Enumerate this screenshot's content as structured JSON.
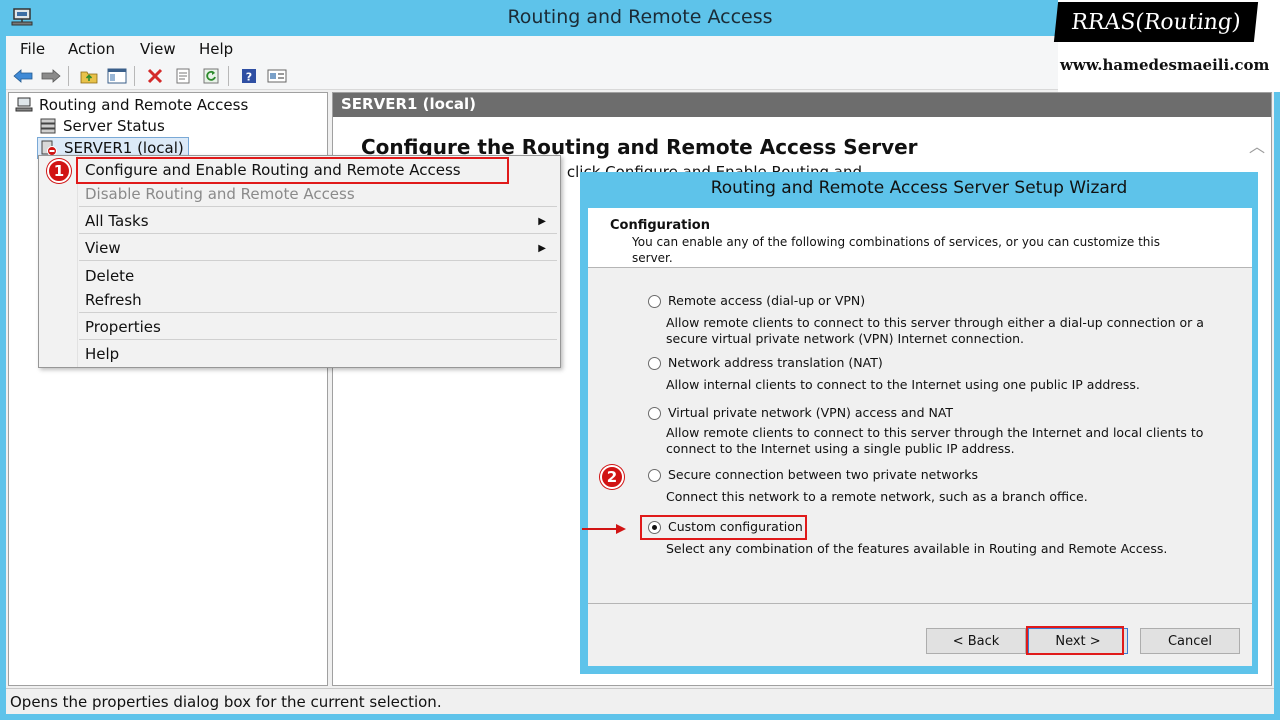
{
  "window": {
    "title": "Routing and Remote Access"
  },
  "menu": [
    "File",
    "Action",
    "View",
    "Help"
  ],
  "toolbar": {
    "icons": [
      "back-arrow-icon",
      "forward-arrow-icon",
      "up-folder-icon",
      "show-hide-tree-icon",
      "delete-icon",
      "properties-icon",
      "refresh-icon",
      "help-icon",
      "mmc-panel-icon"
    ]
  },
  "tree": {
    "root": "Routing and Remote Access",
    "server_status": "Server Status",
    "server": "SERVER1 (local)"
  },
  "right_pane": {
    "header": "SERVER1 (local)",
    "title": "Configure the Routing and Remote Access Server",
    "subtitle_fragment": "Re          ss, on the Action menu, click Configure and Enable Routing and"
  },
  "context_menu": {
    "items": [
      {
        "label": "Configure and Enable Routing and Remote Access",
        "enabled": true
      },
      {
        "label": "Disable Routing and Remote Access",
        "enabled": false
      },
      {
        "label": "All Tasks",
        "enabled": true,
        "submenu": true
      },
      {
        "label": "View",
        "enabled": true,
        "submenu": true
      },
      {
        "label": "Delete",
        "enabled": true
      },
      {
        "label": "Refresh",
        "enabled": true
      },
      {
        "label": "Properties",
        "enabled": true
      },
      {
        "label": "Help",
        "enabled": true
      }
    ]
  },
  "badges": {
    "step1": "1",
    "step2": "2"
  },
  "watermark": {
    "title": "RRAS(Routing)",
    "url": "www.hamedesmaeili.com"
  },
  "wizard": {
    "title": "Routing and Remote Access Server Setup Wizard",
    "header_title": "Configuration",
    "header_desc": "You can enable any of the following combinations of services, or you can customize this server.",
    "options": [
      {
        "label": "Remote access (dial-up or VPN)",
        "desc": "Allow remote clients to connect to this server through either a dial-up connection or a secure virtual private network (VPN) Internet connection.",
        "checked": false
      },
      {
        "label": "Network address translation (NAT)",
        "desc": "Allow internal clients to connect to the Internet using one public IP address.",
        "checked": false
      },
      {
        "label": "Virtual private network (VPN) access and NAT",
        "desc": "Allow remote clients to connect to this server through the Internet and local clients to connect to the Internet using a single public IP address.",
        "checked": false
      },
      {
        "label": "Secure connection between two private networks",
        "desc": "Connect this network to a remote network, such as a branch office.",
        "checked": false
      },
      {
        "label": "Custom configuration",
        "desc": "Select any combination of the features available in Routing and Remote Access.",
        "checked": true
      }
    ],
    "buttons": {
      "back": "< Back",
      "next": "Next >",
      "cancel": "Cancel"
    }
  },
  "status_bar": {
    "text": "Opens the properties dialog box for the current selection."
  },
  "colors": {
    "frame": "#5ec3ea",
    "highlight": "#e01a1a",
    "pane_header": "#6d6d6d"
  }
}
